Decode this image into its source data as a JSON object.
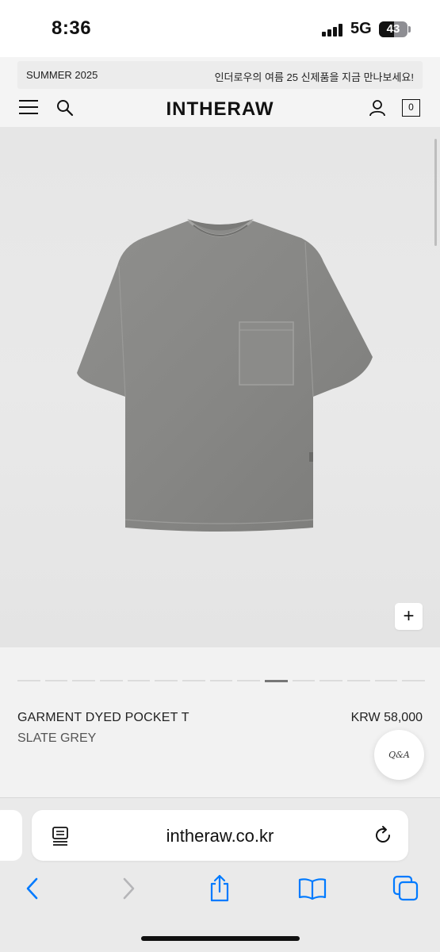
{
  "status_bar": {
    "time": "8:36",
    "network": "5G",
    "battery": "43"
  },
  "header": {
    "banner_left": "SUMMER 2025",
    "banner_right": "인더로우의 여름 25 신제품을 지금 만나보세요!",
    "logo": "INTHERAW",
    "cart_count": "0"
  },
  "gallery": {
    "image_alt": "Grey garment dyed pocket t-shirt",
    "zoom_label": "+",
    "pages_total": 15,
    "active_page": 10
  },
  "product": {
    "name": "GARMENT DYED POCKET T",
    "color": "SLATE GREY",
    "price": "KRW 58,000",
    "qa_label": "Q&A"
  },
  "browser": {
    "url": "intheraw.co.kr"
  },
  "colors": {
    "accent": "#007aff",
    "shirt": "#8a8a88"
  },
  "icons": [
    "menu-icon",
    "search-icon",
    "user-icon",
    "cart-icon",
    "reader-icon",
    "reload-icon",
    "back-icon",
    "forward-icon",
    "share-icon",
    "bookmarks-icon",
    "tabs-icon"
  ]
}
